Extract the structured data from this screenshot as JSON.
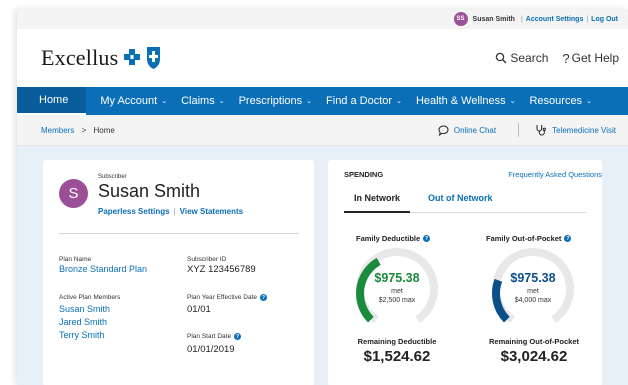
{
  "utility": {
    "avatar_initials": "SS",
    "user_name": "Susan Smith",
    "account_settings": "Account Settings",
    "separator": "|",
    "log_out": "Log Out"
  },
  "brand": {
    "logo_text": "Excellus",
    "search_label": "Search",
    "help_label": "Get Help"
  },
  "nav": [
    {
      "label": "Home",
      "dropdown": false
    },
    {
      "label": "My Account",
      "dropdown": true
    },
    {
      "label": "Claims",
      "dropdown": true
    },
    {
      "label": "Prescriptions",
      "dropdown": true
    },
    {
      "label": "Find a Doctor",
      "dropdown": true
    },
    {
      "label": "Health & Wellness",
      "dropdown": true
    },
    {
      "label": "Resources",
      "dropdown": true
    }
  ],
  "breadcrumb": {
    "parent": "Members",
    "current": "Home",
    "online_chat": "Online Chat",
    "telemedicine": "Telemedicine Visit"
  },
  "subscriber": {
    "role_label": "Subscriber",
    "avatar_initial": "S",
    "name": "Susan Smith",
    "paperless": "Paperless Settings",
    "link_separator": "|",
    "statements": "View Statements",
    "plan_name_label": "Plan Name",
    "plan_name": "Bronze Standard Plan",
    "subscriber_id_label": "Subscriber ID",
    "subscriber_id": "XYZ 123456789",
    "members_label": "Active Plan Members",
    "members": [
      "Susan Smith",
      "Jared Smith",
      "Terry Smith"
    ],
    "effective_label": "Plan Year Effective Date",
    "effective_date": "01/01",
    "start_label": "Plan Start Date",
    "start_date": "01/01/2019"
  },
  "spending": {
    "title": "SPENDING",
    "faq": "Frequently Asked Questions",
    "tab_in": "In Network",
    "tab_out": "Out of Network",
    "deductible": {
      "label": "Family Deductible",
      "amount": "$975.38",
      "met_label": "met",
      "max_label": "$2,500 max",
      "met_value": 975.38,
      "max_value": 2500,
      "color": "#1a8a3c",
      "remaining_label": "Remaining Deductible",
      "remaining": "$1,524.62"
    },
    "oop": {
      "label": "Family Out-of-Pocket",
      "amount": "$975.38",
      "met_label": "met",
      "max_label": "$4,000 max",
      "met_value": 975.38,
      "max_value": 4000,
      "color": "#0b4f8a",
      "remaining_label": "Remaining Out-of-Pocket",
      "remaining": "$3,024.62"
    }
  },
  "colors": {
    "primary_blue": "#0b6fb8",
    "avatar_purple": "#9b4f96",
    "content_bg": "#e7f0f8"
  }
}
